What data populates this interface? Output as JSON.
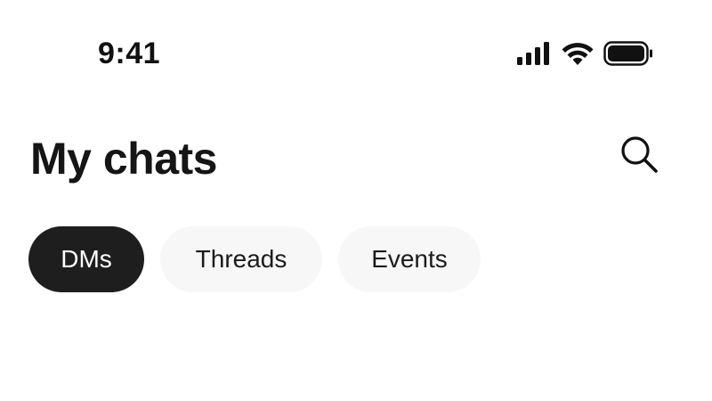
{
  "status_bar": {
    "time": "9:41",
    "icons": [
      "cellular-signal-icon",
      "wifi-icon",
      "battery-icon"
    ]
  },
  "header": {
    "title": "My chats",
    "search_icon": "search-icon"
  },
  "tabs": [
    {
      "label": "DMs",
      "active": true
    },
    {
      "label": "Threads",
      "active": false
    },
    {
      "label": "Events",
      "active": false
    }
  ],
  "colors": {
    "background": "#ffffff",
    "text": "#111111",
    "active_tab_bg": "#1e1e1e",
    "active_tab_text": "#ffffff",
    "inactive_tab_bg": "#f7f7f7"
  }
}
